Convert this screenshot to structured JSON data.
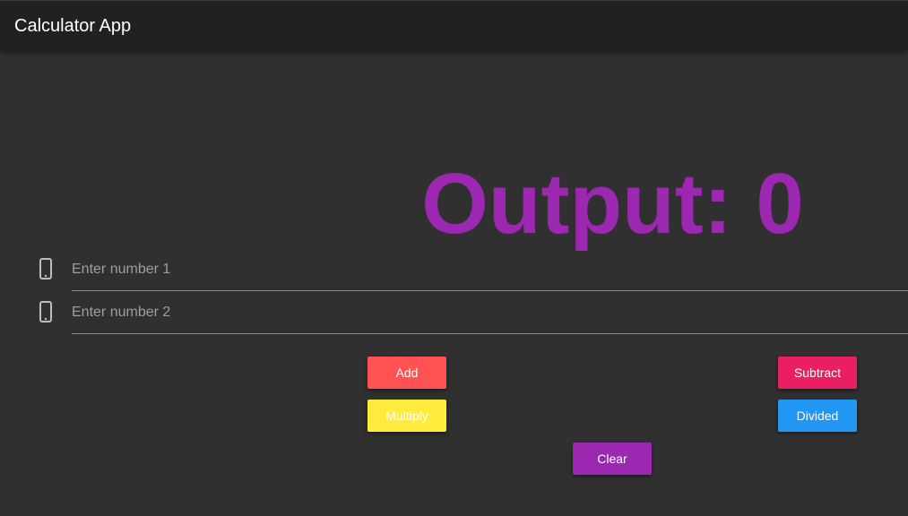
{
  "app": {
    "title": "Calculator App"
  },
  "output": {
    "text": "Output: 0"
  },
  "inputs": [
    {
      "placeholder": "Enter number 1",
      "value": "",
      "icon": "phone-icon"
    },
    {
      "placeholder": "Enter number 2",
      "value": "",
      "icon": "phone-icon"
    }
  ],
  "buttons": {
    "add": {
      "label": "Add",
      "color": "#ff5252"
    },
    "subtract": {
      "label": "Subtract",
      "color": "#e91e63"
    },
    "multiply": {
      "label": "Multiply",
      "color": "#ffeb3b"
    },
    "divide": {
      "label": "Divided",
      "color": "#2196f3"
    },
    "clear": {
      "label": "Clear",
      "color": "#9c27b0"
    }
  },
  "theme": {
    "background": "#303030",
    "appbar": "#212121",
    "accent": "#9c27b0"
  }
}
